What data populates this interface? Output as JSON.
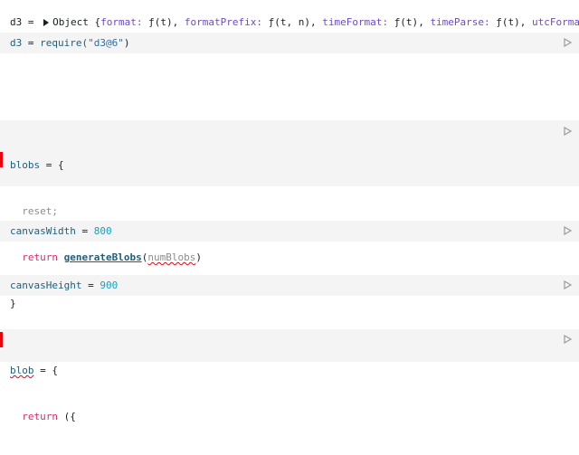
{
  "output": {
    "name": "d3",
    "eq": " = ",
    "obj_label": "Object {",
    "entries": [
      {
        "key": "format",
        "val": "ƒ(t)"
      },
      {
        "key": "formatPrefix",
        "val": "ƒ(t, n)"
      },
      {
        "key": "timeFormat",
        "val": "ƒ(t)"
      },
      {
        "key": "timeParse",
        "val": "ƒ(t)"
      },
      {
        "key": "utcFormat",
        "val": ""
      }
    ]
  },
  "cells": {
    "d3": {
      "name": "d3",
      "eq": " = ",
      "fn": "require(",
      "arg": "\"d3@6\"",
      "close": ")"
    },
    "blobs": {
      "name": "blobs",
      "eq": " = {",
      "line2": "reset;",
      "kw": "return",
      "call": "generateBlobs",
      "paren_open": "(",
      "arg": "numBlobs",
      "paren_close": ")",
      "close": "}"
    },
    "canvasWidth": {
      "name": "canvasWidth",
      "eq": " = ",
      "value": "800"
    },
    "canvasHeight": {
      "name": "canvasHeight",
      "eq": " = ",
      "value": "900"
    },
    "blob": {
      "name": "blob",
      "eq": " = {",
      "kw": "return",
      "rest": " ({"
    }
  }
}
